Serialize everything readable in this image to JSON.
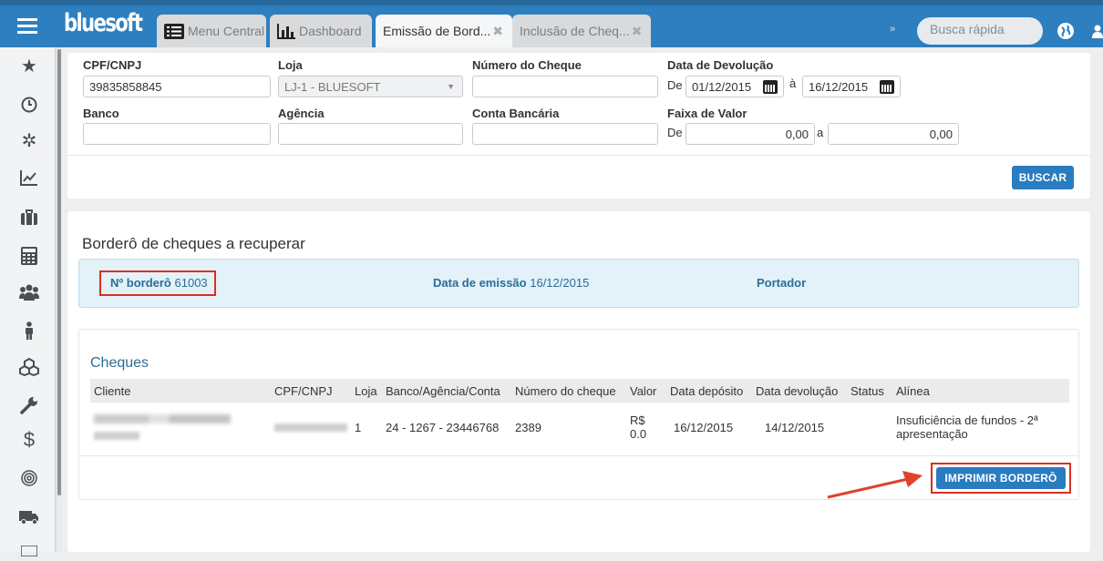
{
  "app": {
    "logo": "bluesoft",
    "tabs": [
      {
        "label": "Menu Central",
        "icon": "list-icon",
        "active": false,
        "closable": false
      },
      {
        "label": "Dashboard",
        "icon": "bar-chart-icon",
        "active": false,
        "closable": false
      },
      {
        "label": "Emissão de Bord...",
        "active": true,
        "closable": true
      },
      {
        "label": "Inclusão de Cheq...",
        "active": false,
        "closable": true
      }
    ],
    "search_placeholder": "Busca rápida"
  },
  "filters": {
    "cpf_label": "CPF/CNPJ",
    "cpf_value": "39835858845",
    "loja_label": "Loja",
    "loja_value": "LJ-1 - BLUESOFT",
    "numero_cheque_label": "Número do Cheque",
    "numero_cheque_value": "",
    "data_devolucao_label": "Data de Devolução",
    "de_label": "De",
    "ate_label": "à",
    "data_de_value": "01/12/2015",
    "data_ate_value": "16/12/2015",
    "banco_label": "Banco",
    "banco_value": "",
    "agencia_label": "Agência",
    "agencia_value": "",
    "conta_label": "Conta Bancária",
    "conta_value": "",
    "faixa_label": "Faixa de Valor",
    "faixa_de_label": "De",
    "faixa_a_label": "a",
    "faixa_de_value": "0,00",
    "faixa_ate_value": "0,00",
    "buscar_label": "BUSCAR"
  },
  "bordero": {
    "title": "Borderô de cheques a recuperar",
    "numero_label": "Nº borderô",
    "numero_value": "61003",
    "emissao_label": "Data de emissão",
    "emissao_value": "16/12/2015",
    "portador_label": "Portador",
    "cheques_title": "Cheques",
    "columns": [
      "Cliente",
      "CPF/CNPJ",
      "Loja",
      "Banco/Agência/Conta",
      "Número do cheque",
      "Valor",
      "Data depósito",
      "Data devolução",
      "Status",
      "Alínea"
    ],
    "rows": [
      {
        "loja": "1",
        "banco": "24 - 1267 - 23446768",
        "numero": "2389",
        "valor_1": "R$",
        "valor_2": "0.0",
        "data_deposito": "16/12/2015",
        "data_devolucao": "14/12/2015",
        "status": "",
        "alinea_1": "Insuficiência de fundos - 2ª",
        "alinea_2": "apresentação"
      }
    ],
    "print_label": "IMPRIMIR BORDERÔ"
  },
  "colors": {
    "topbar": "#2d7fbf",
    "accent": "#2a7cc0",
    "highlight": "#d9301f"
  }
}
